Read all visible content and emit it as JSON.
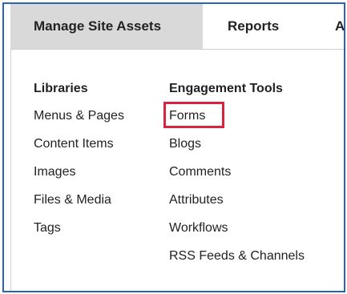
{
  "tabs": {
    "manage_site_assets": "Manage Site Assets",
    "reports": "Reports",
    "admin_truncated": "Ad"
  },
  "libraries": {
    "heading": "Libraries",
    "items": [
      "Menus & Pages",
      "Content Items",
      "Images",
      "Files & Media",
      "Tags"
    ]
  },
  "engagement_tools": {
    "heading": "Engagement Tools",
    "items": [
      "Forms",
      "Blogs",
      "Comments",
      "Attributes",
      "Workflows",
      "RSS Feeds & Channels"
    ]
  },
  "colors": {
    "frame_border": "#2a63b8",
    "active_tab_bg": "#d9d9d9",
    "highlight": "#d8243f"
  }
}
